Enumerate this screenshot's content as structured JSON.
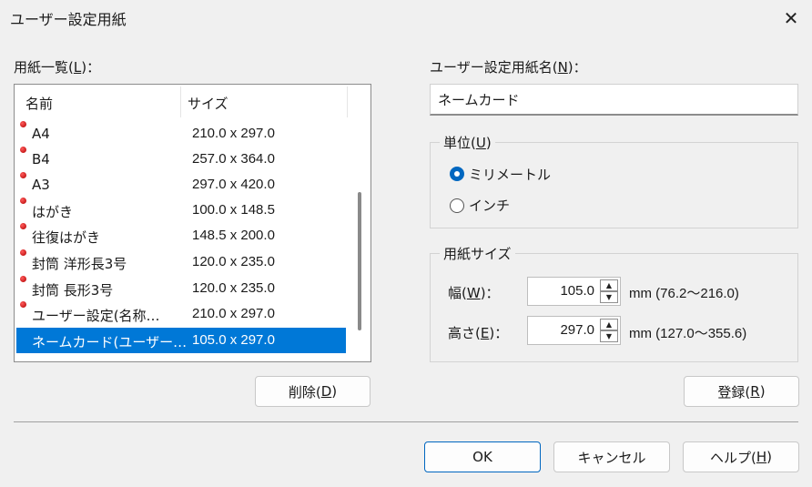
{
  "window": {
    "title": "ユーザー設定用紙"
  },
  "list": {
    "label": "用紙一覧(",
    "label_key": "L",
    "label_tail": ")：",
    "col_name": "名前",
    "col_size": "サイズ",
    "rows": [
      {
        "name": "A4",
        "size": "210.0 x 297.0"
      },
      {
        "name": "B4",
        "size": "257.0 x 364.0"
      },
      {
        "name": "A3",
        "size": "297.0 x 420.0"
      },
      {
        "name": "はがき",
        "size": "100.0 x 148.5"
      },
      {
        "name": "往復はがき",
        "size": "148.5 x 200.0"
      },
      {
        "name": "封筒 洋形長3号",
        "size": "120.0 x 235.0"
      },
      {
        "name": "封筒 長形3号",
        "size": "120.0 x 235.0"
      },
      {
        "name": "ユーザー設定(名称…",
        "size": "210.0 x 297.0"
      },
      {
        "name": "ネームカード(ユーザー…",
        "size": "105.0 x 297.0"
      }
    ]
  },
  "delete_button": {
    "label": "削除(",
    "key": "D",
    "tail": ")"
  },
  "name_field": {
    "label": "ユーザー設定用紙名(",
    "key": "N",
    "tail": ")：",
    "value": "ネームカード"
  },
  "unit": {
    "label": "単位(",
    "key": "U",
    "tail": ")",
    "option_mm": "ミリメートル",
    "option_inch": "インチ"
  },
  "paper_size": {
    "label": "用紙サイズ",
    "width_label": "幅(",
    "width_key": "W",
    "width_tail": ")：",
    "width_value": "105.0",
    "width_range": "mm (76.2～216.0)",
    "height_label": "高さ(",
    "height_key": "E",
    "height_tail": ")：",
    "height_value": "297.0",
    "height_range": "mm (127.0～355.6)"
  },
  "register_button": {
    "label": "登録(",
    "key": "R",
    "tail": ")"
  },
  "footer": {
    "ok": "OK",
    "cancel": "キャンセル",
    "help": "ヘルプ(",
    "help_key": "H",
    "help_tail": ")"
  },
  "icons": {
    "close": "close-icon",
    "bullet": "red-dot-icon"
  }
}
